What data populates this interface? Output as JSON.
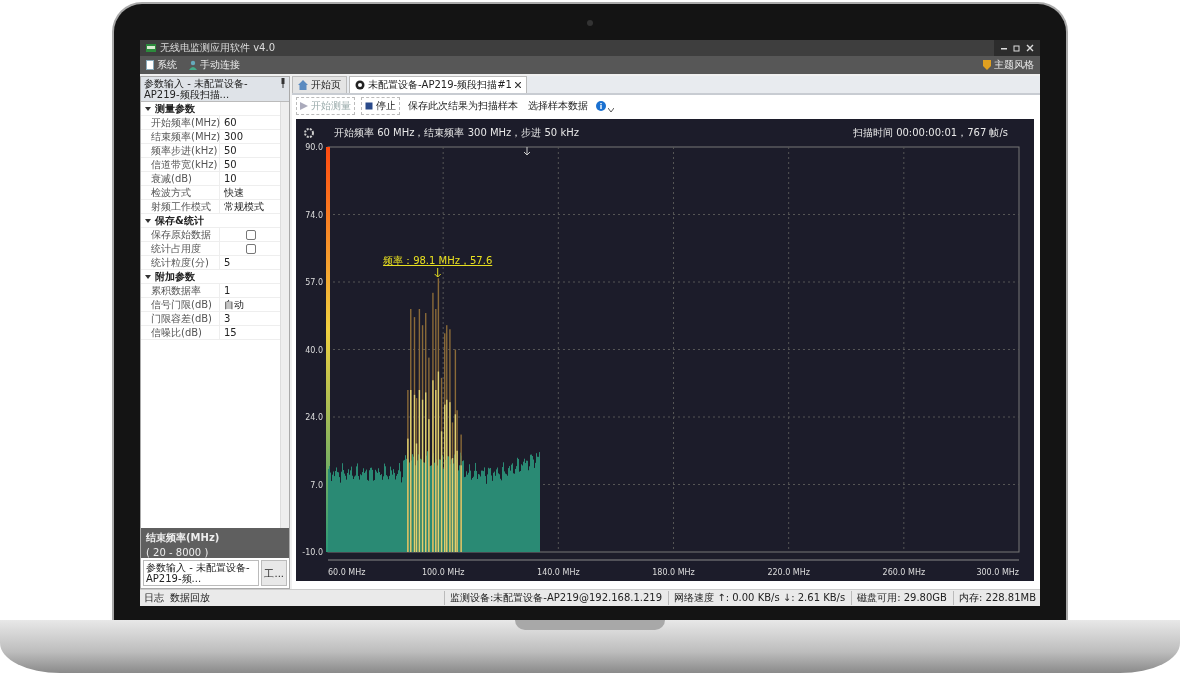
{
  "window": {
    "title": "无线电监测应用软件 v4.0"
  },
  "menu": [
    {
      "label": "系统",
      "kind": "system"
    },
    {
      "label": "手动连接",
      "kind": "connect"
    }
  ],
  "theme_button": {
    "label": "主题风格"
  },
  "left_panel": {
    "title": "参数输入 - 未配置设备-AP219-频段扫描...",
    "groups": [
      {
        "title": "测量参数",
        "expanded": true,
        "rows": [
          {
            "label": "开始频率(MHz)",
            "kind": "text",
            "value": "60"
          },
          {
            "label": "结束频率(MHz)",
            "kind": "text",
            "value": "300"
          },
          {
            "label": "频率步进(kHz)",
            "kind": "text",
            "value": "50"
          },
          {
            "label": "信道带宽(kHz)",
            "kind": "text",
            "value": "50"
          },
          {
            "label": "衰减(dB)",
            "kind": "text",
            "value": "10"
          },
          {
            "label": "检波方式",
            "kind": "text",
            "value": "快速"
          },
          {
            "label": "射频工作模式",
            "kind": "text",
            "value": "常规模式"
          }
        ]
      },
      {
        "title": "保存&统计",
        "expanded": true,
        "rows": [
          {
            "label": "保存原始数据",
            "kind": "checkbox",
            "checked": false
          },
          {
            "label": "统计占用度",
            "kind": "checkbox",
            "checked": false
          },
          {
            "label": "统计粒度(分)",
            "kind": "text",
            "value": "5"
          }
        ]
      },
      {
        "title": "附加参数",
        "expanded": true,
        "rows": [
          {
            "label": "累积数据率",
            "kind": "text",
            "value": "1"
          },
          {
            "label": "信号门限(dB)",
            "kind": "text",
            "value": "自动"
          },
          {
            "label": "门限容差(dB)",
            "kind": "text",
            "value": "3"
          },
          {
            "label": "信噪比(dB)",
            "kind": "text",
            "value": "15"
          }
        ]
      }
    ],
    "description": {
      "title": "结束频率(MHz)",
      "text": "( 20 - 8000 )"
    },
    "bottom_tabs": [
      {
        "label": "参数输入 - 未配置设备-AP219-频...",
        "selected": true
      },
      {
        "label": "工...",
        "selected": false
      }
    ]
  },
  "tabs": [
    {
      "label": "开始页",
      "selected": false,
      "closable": false
    },
    {
      "label": "未配置设备-AP219-频段扫描#1",
      "selected": true,
      "closable": true
    }
  ],
  "toolbar": [
    {
      "label": "开始测量",
      "kind": "start",
      "disabled": true
    },
    {
      "label": "停止",
      "kind": "stop",
      "disabled": false
    },
    {
      "label": "保存此次结果为扫描样本",
      "kind": "link",
      "disabled": false
    },
    {
      "label": "选择样本数据",
      "kind": "link",
      "disabled": false
    }
  ],
  "chart": {
    "header": "开始频率 60 MHz，结束频率 300 MHz，步进 50 kHz",
    "scan_info": "扫描时间 00:00:00:01，767 帧/s",
    "marker": "频率：98.1 MHz，57.6",
    "yticks": [
      "90.0",
      "74.0",
      "57.0",
      "40.0",
      "24.0",
      "7.0",
      "-10.0"
    ],
    "xticks": [
      "60.0 MHz",
      "100.0 MHz",
      "140.0 MHz",
      "180.0 MHz",
      "220.0 MHz",
      "260.0 MHz",
      "300.0 MHz"
    ]
  },
  "status_bar": {
    "left": [
      "日志",
      "数据回放"
    ],
    "right": [
      "监测设备:未配置设备-AP219@192.168.1.219",
      "网络速度 ↑: 0.00 KB/s ↓: 2.61 KB/s",
      "磁盘可用: 29.80GB",
      "内存: 228.81MB"
    ]
  }
}
